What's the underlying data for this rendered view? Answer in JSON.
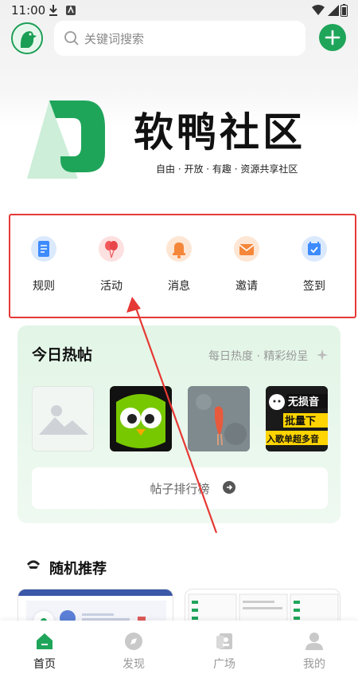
{
  "status_bar": {
    "time": "11:00"
  },
  "search": {
    "placeholder": "关键词搜索"
  },
  "brand": {
    "title": "软鸭社区",
    "slogan": "自由 · 开放 · 有趣 · 资源共享社区"
  },
  "quick_menu": [
    {
      "label": "规则",
      "icon": "document-icon",
      "color": "#3d8bfd"
    },
    {
      "label": "活动",
      "icon": "balloon-icon",
      "color": "#f0585a"
    },
    {
      "label": "消息",
      "icon": "bell-icon",
      "color": "#f5873a"
    },
    {
      "label": "邀请",
      "icon": "mail-icon",
      "color": "#f5873a"
    },
    {
      "label": "签到",
      "icon": "calendar-check-icon",
      "color": "#3d8bfd"
    }
  ],
  "hot_posts": {
    "title": "今日热帖",
    "subtitle": "每日热度 · 精彩纷呈",
    "thumb_texts": [
      "无损音",
      "批量下",
      "入歌单超多音"
    ],
    "rank_button": "帖子排行榜"
  },
  "random": {
    "title": "随机推荐"
  },
  "bottom_nav": [
    {
      "label": "首页",
      "icon": "home-icon",
      "active": true
    },
    {
      "label": "发现",
      "icon": "compass-icon",
      "active": false
    },
    {
      "label": "广场",
      "icon": "square-icon",
      "active": false
    },
    {
      "label": "我的",
      "icon": "user-icon",
      "active": false
    }
  ],
  "colors": {
    "brand_green": "#1fa55a",
    "highlight_red": "#e53935"
  }
}
